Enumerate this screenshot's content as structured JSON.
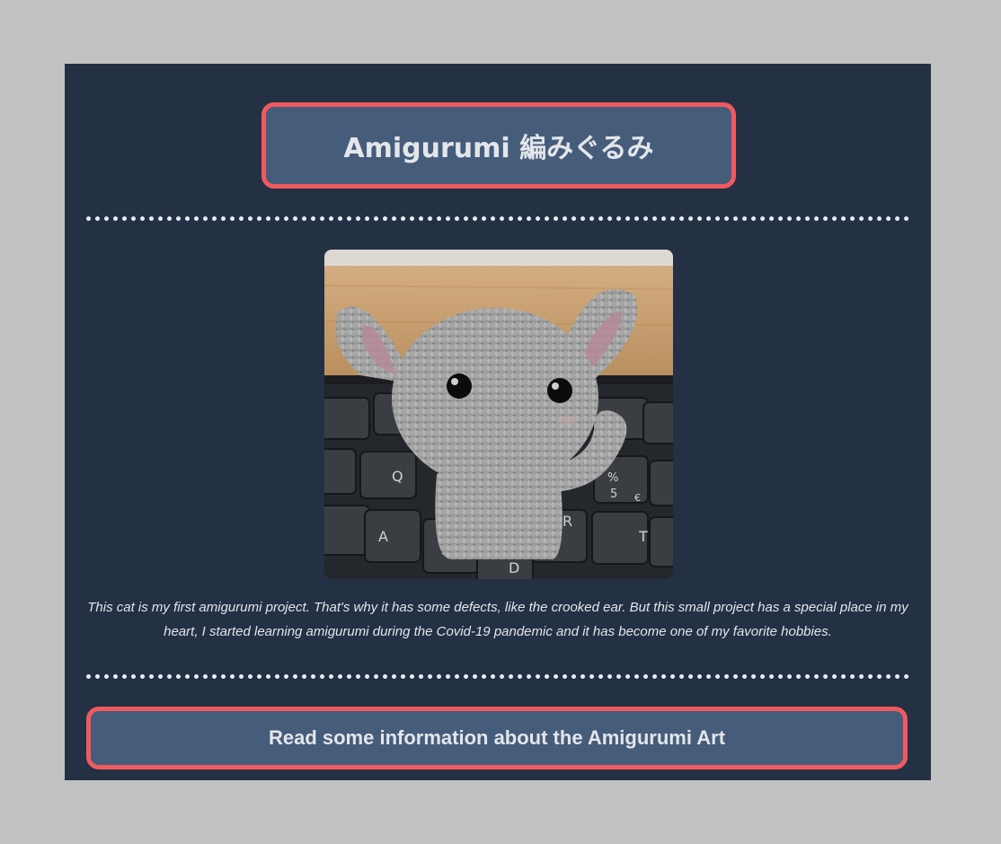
{
  "header": {
    "title": "Amigurumi 編みぐるみ"
  },
  "figure": {
    "image_subject": "crochet-gray-cat-on-keyboard",
    "caption": "This cat is my first amigurumi project. That's why it has some defects, like the crooked ear. But this small project has a special place in my heart, I started learning amigurumi during the Covid-19 pandemic and it has become one of my favorite hobbies."
  },
  "cta": {
    "label": "Read some information about the Amigurumi Art"
  },
  "colors": {
    "page_background": "#c2c2c2",
    "card_background": "#243044",
    "box_fill": "#465c7b",
    "accent_border": "#f05a5f",
    "text": "#e3e6ea",
    "divider": "#e9edf2"
  }
}
